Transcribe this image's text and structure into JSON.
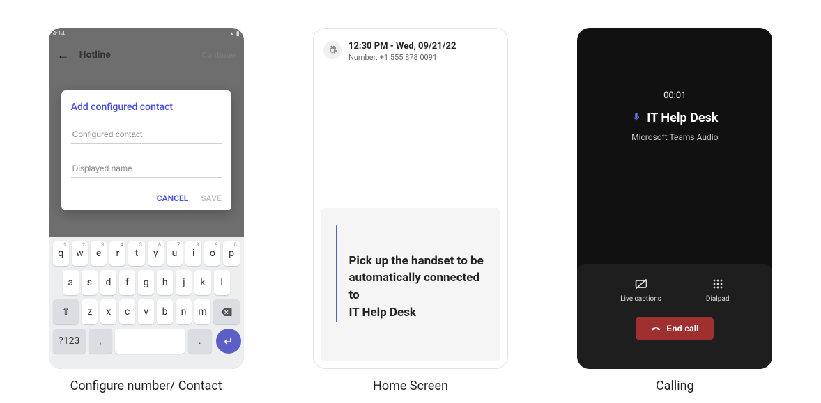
{
  "phone1": {
    "statusbar": {
      "time": "4:14"
    },
    "topbar": {
      "title": "Hotline",
      "continue": "Continue"
    },
    "dialog": {
      "title": "Add configured contact",
      "field1_placeholder": "Configured contact",
      "field2_placeholder": "Displayed name",
      "cancel": "CANCEL",
      "save": "SAVE"
    },
    "keyboard": {
      "row1": [
        {
          "k": "q",
          "n": "1"
        },
        {
          "k": "w",
          "n": "2"
        },
        {
          "k": "e",
          "n": "3"
        },
        {
          "k": "r",
          "n": "4"
        },
        {
          "k": "t",
          "n": "5"
        },
        {
          "k": "y",
          "n": "6"
        },
        {
          "k": "u",
          "n": "7"
        },
        {
          "k": "i",
          "n": "8"
        },
        {
          "k": "o",
          "n": "9"
        },
        {
          "k": "p",
          "n": "0"
        }
      ],
      "row2": [
        "a",
        "s",
        "d",
        "f",
        "g",
        "h",
        "j",
        "k",
        "l"
      ],
      "row3": [
        "z",
        "x",
        "c",
        "v",
        "b",
        "n",
        "m"
      ],
      "sym_key": "?123",
      "comma": ",",
      "period": "."
    },
    "caption": "Configure number/ Contact"
  },
  "phone2": {
    "datetime": "12:30 PM - Wed, 09/21/22",
    "number_label": "Number: +1 555 878 0091",
    "card_text": "Pick up the handset to be automatically connected to\nIT Help Desk",
    "caption": "Home Screen"
  },
  "phone3": {
    "timer": "00:01",
    "title": "IT Help Desk",
    "subtitle": "Microsoft Teams Audio",
    "actions": {
      "captions": "Live captions",
      "dialpad": "Dialpad"
    },
    "end": "End call",
    "caption": "Calling"
  }
}
